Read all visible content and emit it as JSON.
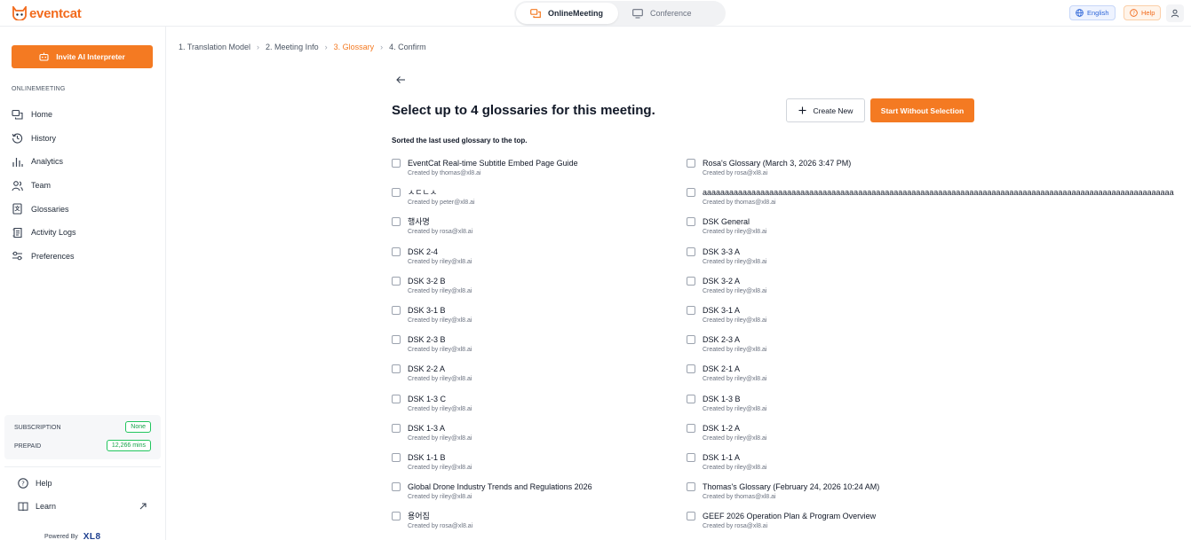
{
  "app": {
    "brand": "eventcat",
    "modes": [
      "OnlineMeeting",
      "Conference"
    ],
    "language": "English",
    "help": "Help"
  },
  "sidebar": {
    "invite_label": "Invite AI Interpreter",
    "section": "ONLINEMEETING",
    "items": [
      {
        "label": "Home",
        "icon": "chat-icon"
      },
      {
        "label": "History",
        "icon": "history-icon"
      },
      {
        "label": "Analytics",
        "icon": "bar-chart-icon"
      },
      {
        "label": "Team",
        "icon": "team-icon"
      },
      {
        "label": "Glossaries",
        "icon": "glossary-icon"
      },
      {
        "label": "Activity Logs",
        "icon": "logs-icon"
      },
      {
        "label": "Preferences",
        "icon": "sliders-icon"
      }
    ],
    "subscription_label": "SUBSCRIPTION",
    "subscription_value": "None",
    "prepaid_label": "PREPAID",
    "prepaid_value": "12,266 mins",
    "help": "Help",
    "learn": "Learn",
    "powered_by": "Powered By",
    "powered_brand": "XL8"
  },
  "breadcrumbs": [
    "1. Translation Model",
    "2. Meeting Info",
    "3. Glossary",
    "4. Confirm"
  ],
  "main": {
    "title": "Select up to 4 glossaries for this meeting.",
    "create_new": "Create New",
    "start_without": "Start Without Selection",
    "sorted_note": "Sorted the last used glossary to the top.",
    "left": [
      {
        "name": "EventCat Real-time Subtitle Embed Page Guide",
        "by": "Created by thomas@xl8.ai"
      },
      {
        "name": "ㅅㄷㄴㅅ",
        "by": "Created by peter@xl8.ai"
      },
      {
        "name": "행사명",
        "by": "Created by rosa@xl8.ai"
      },
      {
        "name": "DSK 2-4",
        "by": "Created by riley@xl8.ai"
      },
      {
        "name": "DSK 3-2 B",
        "by": "Created by riley@xl8.ai"
      },
      {
        "name": "DSK 3-1 B",
        "by": "Created by riley@xl8.ai"
      },
      {
        "name": "DSK 2-3 B",
        "by": "Created by riley@xl8.ai"
      },
      {
        "name": "DSK 2-2 A",
        "by": "Created by riley@xl8.ai"
      },
      {
        "name": "DSK 1-3 C",
        "by": "Created by riley@xl8.ai"
      },
      {
        "name": "DSK 1-3 A",
        "by": "Created by riley@xl8.ai"
      },
      {
        "name": "DSK 1-1 B",
        "by": "Created by riley@xl8.ai"
      },
      {
        "name": "Global Drone Industry Trends and Regulations 2026",
        "by": "Created by riley@xl8.ai"
      },
      {
        "name": "용어집",
        "by": "Created by rosa@xl8.ai"
      }
    ],
    "right": [
      {
        "name": "Rosa's Glossary (March 3, 2026 3:47 PM)",
        "by": "Created by rosa@xl8.ai"
      },
      {
        "name": "aaaaaaaaaaaaaaaaaaaaaaaaaaaaaaaaaaaaaaaaaaaaaaaaaaaaaaaaaaaaaaaaaaaaaaaaaaaaaaaaaaaaaaaaaaaaaaaaaaaaaaaaaa",
        "by": "Created by thomas@xl8.ai"
      },
      {
        "name": "DSK General",
        "by": "Created by riley@xl8.ai"
      },
      {
        "name": "DSK 3-3 A",
        "by": "Created by riley@xl8.ai"
      },
      {
        "name": "DSK 3-2 A",
        "by": "Created by riley@xl8.ai"
      },
      {
        "name": "DSK 3-1 A",
        "by": "Created by riley@xl8.ai"
      },
      {
        "name": "DSK 2-3 A",
        "by": "Created by riley@xl8.ai"
      },
      {
        "name": "DSK 2-1 A",
        "by": "Created by riley@xl8.ai"
      },
      {
        "name": "DSK 1-3 B",
        "by": "Created by riley@xl8.ai"
      },
      {
        "name": "DSK 1-2 A",
        "by": "Created by riley@xl8.ai"
      },
      {
        "name": "DSK 1-1 A",
        "by": "Created by riley@xl8.ai"
      },
      {
        "name": "Thomas's Glossary (February 24, 2026 10:24 AM)",
        "by": "Created by thomas@xl8.ai"
      },
      {
        "name": "GEEF 2026 Operation Plan & Program Overview",
        "by": "Created by rosa@xl8.ai"
      }
    ]
  },
  "colors": {
    "accent": "#f47a22",
    "green": "#22c55e",
    "blue": "#2f67d8"
  }
}
